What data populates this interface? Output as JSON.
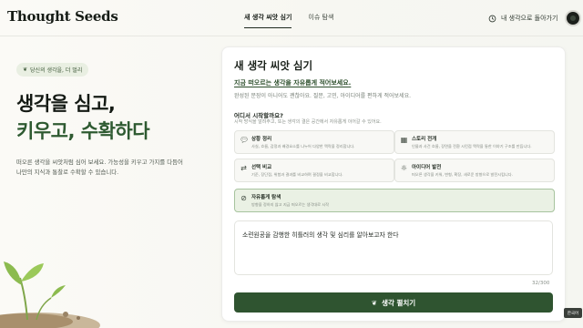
{
  "header": {
    "logo": "Thought Seeds",
    "tabs": [
      {
        "label": "새 생각 씨앗 심기",
        "active": true
      },
      {
        "label": "이슈 탐색",
        "active": false
      }
    ],
    "back_label": "내 생각으로 돌아가기"
  },
  "hero": {
    "badge": "당신의 생각을, 더 멀리",
    "title_line1": "생각을 심고,",
    "title_line2": "키우고, 수확하다",
    "desc": "떠오른 생각을 씨앗처럼 심어 보세요. 가능성을 키우고 가지를 다듬어 나만의 지식과 통찰로 수확할 수 있습니다."
  },
  "card": {
    "title": "새 생각 씨앗 심기",
    "subtitle": "지금 떠오르는 생각을 자유롭게 적어보세요.",
    "help": "완성된 문장이 아니어도 괜찮아요. 질문, 고민, 아이디어를 편하게 적어보세요.",
    "section_title": "어디서 시작할까요?",
    "section_help": "시작 방식을 알려주고, 또는 생각의 결은 공간에서 자유롭게 이어갈 수 있어요.",
    "options": [
      {
        "title": "상황 정리",
        "desc": "사실, 흐름, 감정과 배경요소를 나누어 다양한 맥락을 정리합니다.",
        "icon": "chat-bubble-icon"
      },
      {
        "title": "스토리 전개",
        "desc": "인물과 사건 흐름, 장면을 전환 시킨점 맥락을 통한 이야기 구조를 만듭니다.",
        "icon": "story-board-icon"
      },
      {
        "title": "선택 비교",
        "desc": "기준, 장단점, 위험과 결과를 비교하며 결정을 비교합니다.",
        "icon": "compare-icon"
      },
      {
        "title": "아이디어 발전",
        "desc": "떠오른 생각을 키워, 변형, 확장, 새로운 방향으로 발전시킵니다.",
        "icon": "lightbulb-icon"
      },
      {
        "title": "자유롭게 탐색",
        "desc": "방향을 정하지 않고 지금 떠오르는 생각대로 시작",
        "icon": "compass-icon"
      }
    ],
    "input_value": "소련원공을 감행한 히틀러의 생각 및 심리를 알아보고자 한다",
    "counter": "32/300",
    "submit_label": "생각 펼치기"
  },
  "lang_button": "한국어",
  "colors": {
    "accent": "#2f5430",
    "selected_bg": "#eaf1e4"
  }
}
